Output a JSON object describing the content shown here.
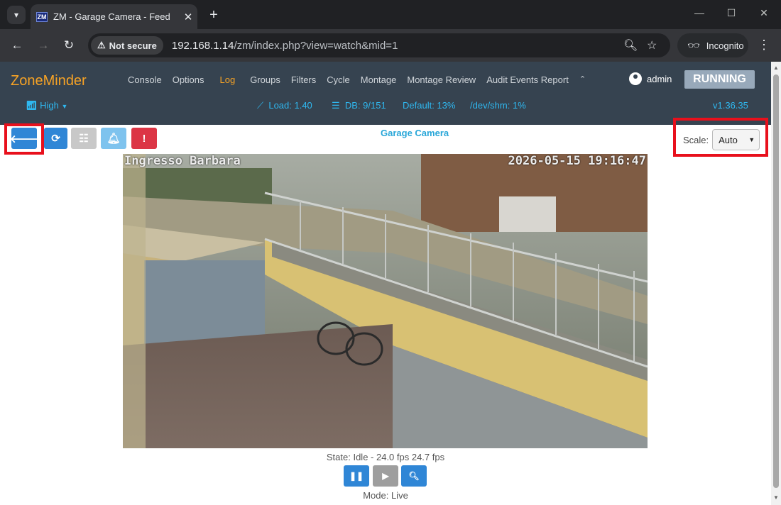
{
  "browser": {
    "tab_title": "ZM - Garage Camera - Feed",
    "favicon_text": "ZM",
    "security_label": "Not secure",
    "url_host": "192.168.1.14",
    "url_path": "/zm/index.php?view=watch&mid=1",
    "profile_label": "Incognito"
  },
  "navbar": {
    "logo": "ZoneMinder",
    "menu": [
      "Console",
      "Options",
      "Log",
      "Groups",
      "Filters",
      "Cycle",
      "Montage",
      "Montage Review",
      "Audit Events Report"
    ],
    "active_menu": "Log",
    "user": "admin",
    "status": "RUNNING",
    "bandwidth": "High",
    "load": "Load: 1.40",
    "db": "DB: 9/151",
    "default_disk": "Default: 13%",
    "shm": "/dev/shm: 1%",
    "version": "v1.36.35"
  },
  "monitor": {
    "name": "Garage Camera",
    "scale_label": "Scale:",
    "scale_value": "Auto",
    "osd_left": "Ingresso Barbara",
    "osd_right": "2026-05-15 19:16:47",
    "state_text": "State: Idle - 24.0 fps 24.7 fps",
    "mode_text": "Mode: Live"
  },
  "colors": {
    "accent_orange": "#f7a325",
    "navbar_bg": "#364350",
    "link_blue": "#2fb8f0",
    "button_blue": "#2f86d6",
    "alarm_red": "#dc3545",
    "highlight_red": "#e8101c"
  }
}
